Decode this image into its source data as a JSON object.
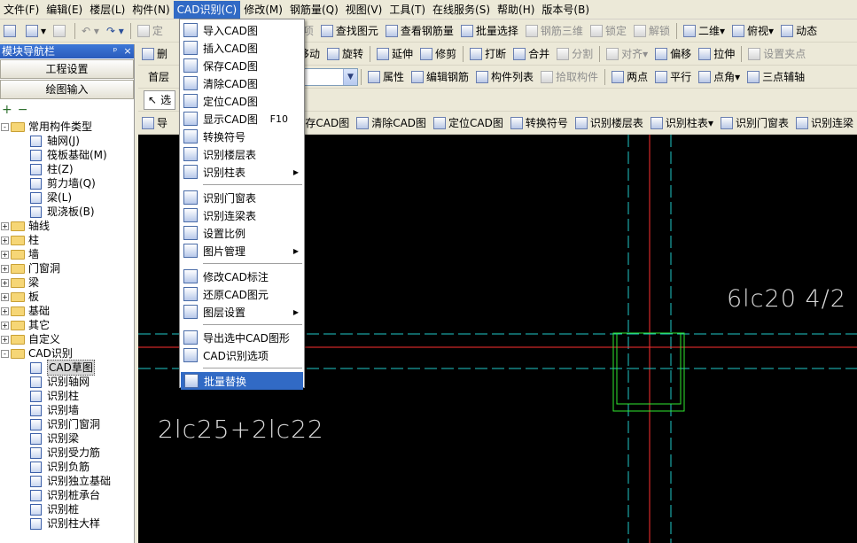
{
  "menubar": [
    "文件(F)",
    "编辑(E)",
    "楼层(L)",
    "构件(N)",
    "CAD识别(C)",
    "修改(M)",
    "钢筋量(Q)",
    "视图(V)",
    "工具(T)",
    "在线服务(S)",
    "帮助(H)",
    "版本号(B)"
  ],
  "toolbar1": {
    "items": [
      "定",
      "项",
      "查找图元",
      "查看钢筋量",
      "批量选择",
      "钢筋三维",
      "锁定",
      "解锁",
      "二维",
      "俯视",
      "动态"
    ]
  },
  "toolbar2": {
    "items": [
      "删",
      "移动",
      "旋转",
      "延伸",
      "修剪",
      "打断",
      "合并",
      "分割",
      "对齐",
      "偏移",
      "拉伸",
      "设置夹点"
    ]
  },
  "toolbar3": {
    "floor": "首层",
    "items": [
      "属性",
      "编辑钢筋",
      "构件列表",
      "拾取构件",
      "两点",
      "平行",
      "点角",
      "三点辅轴"
    ]
  },
  "toolbar4": {
    "select": "选"
  },
  "toolbar5": {
    "items": [
      "导",
      "保存CAD图",
      "清除CAD图",
      "定位CAD图",
      "转换符号",
      "识别楼层表",
      "识别柱表",
      "识别门窗表",
      "识别连梁"
    ]
  },
  "leftpanel": {
    "title": "模块导航栏",
    "pin": "ᵖ",
    "close": "×",
    "btn1": "工程设置",
    "btn2": "绘图输入",
    "tree": [
      {
        "label": "常用构件类型",
        "level": 0,
        "exp": "-",
        "kind": "folder"
      },
      {
        "label": "轴网(J)",
        "level": 1,
        "kind": "node"
      },
      {
        "label": "筏板基础(M)",
        "level": 1,
        "kind": "node"
      },
      {
        "label": "柱(Z)",
        "level": 1,
        "kind": "node"
      },
      {
        "label": "剪力墙(Q)",
        "level": 1,
        "kind": "node"
      },
      {
        "label": "梁(L)",
        "level": 1,
        "kind": "node"
      },
      {
        "label": "现浇板(B)",
        "level": 1,
        "kind": "node"
      },
      {
        "label": "轴线",
        "level": 0,
        "exp": "+",
        "kind": "folder"
      },
      {
        "label": "柱",
        "level": 0,
        "exp": "+",
        "kind": "folder"
      },
      {
        "label": "墙",
        "level": 0,
        "exp": "+",
        "kind": "folder"
      },
      {
        "label": "门窗洞",
        "level": 0,
        "exp": "+",
        "kind": "folder"
      },
      {
        "label": "梁",
        "level": 0,
        "exp": "+",
        "kind": "folder"
      },
      {
        "label": "板",
        "level": 0,
        "exp": "+",
        "kind": "folder"
      },
      {
        "label": "基础",
        "level": 0,
        "exp": "+",
        "kind": "folder"
      },
      {
        "label": "其它",
        "level": 0,
        "exp": "+",
        "kind": "folder"
      },
      {
        "label": "自定义",
        "level": 0,
        "exp": "+",
        "kind": "folder"
      },
      {
        "label": "CAD识别",
        "level": 0,
        "exp": "-",
        "kind": "folder"
      },
      {
        "label": "CAD草图",
        "level": 1,
        "kind": "node",
        "selected": true
      },
      {
        "label": "识别轴网",
        "level": 1,
        "kind": "node"
      },
      {
        "label": "识别柱",
        "level": 1,
        "kind": "node"
      },
      {
        "label": "识别墙",
        "level": 1,
        "kind": "node"
      },
      {
        "label": "识别门窗洞",
        "level": 1,
        "kind": "node"
      },
      {
        "label": "识别梁",
        "level": 1,
        "kind": "node"
      },
      {
        "label": "识别受力筋",
        "level": 1,
        "kind": "node"
      },
      {
        "label": "识别负筋",
        "level": 1,
        "kind": "node"
      },
      {
        "label": "识别独立基础",
        "level": 1,
        "kind": "node"
      },
      {
        "label": "识别桩承台",
        "level": 1,
        "kind": "node"
      },
      {
        "label": "识别桩",
        "level": 1,
        "kind": "node"
      },
      {
        "label": "识别柱大样",
        "level": 1,
        "kind": "node"
      }
    ]
  },
  "dropdown": {
    "items": [
      {
        "label": "导入CAD图"
      },
      {
        "label": "插入CAD图"
      },
      {
        "label": "保存CAD图"
      },
      {
        "label": "清除CAD图"
      },
      {
        "label": "定位CAD图"
      },
      {
        "label": "显示CAD图",
        "shortcut": "F10"
      },
      {
        "label": "转换符号"
      },
      {
        "label": "识别楼层表"
      },
      {
        "label": "识别柱表",
        "submenu": true
      },
      {
        "sep": true
      },
      {
        "label": "识别门窗表"
      },
      {
        "label": "识别连梁表"
      },
      {
        "label": "设置比例"
      },
      {
        "label": "图片管理",
        "submenu": true
      },
      {
        "sep": true
      },
      {
        "label": "修改CAD标注"
      },
      {
        "label": "还原CAD图元"
      },
      {
        "label": "图层设置",
        "submenu": true
      },
      {
        "sep": true
      },
      {
        "label": "导出选中CAD图形"
      },
      {
        "label": "CAD识别选项"
      },
      {
        "sep": true
      },
      {
        "label": "批量替换",
        "highlighted": true
      }
    ]
  },
  "canvas": {
    "text1": "6lc20 4/2",
    "text2": "2lc25+2lc22",
    "colors": {
      "red": "#FF3030",
      "cyan": "#20C8C8",
      "green": "#30E830"
    }
  }
}
